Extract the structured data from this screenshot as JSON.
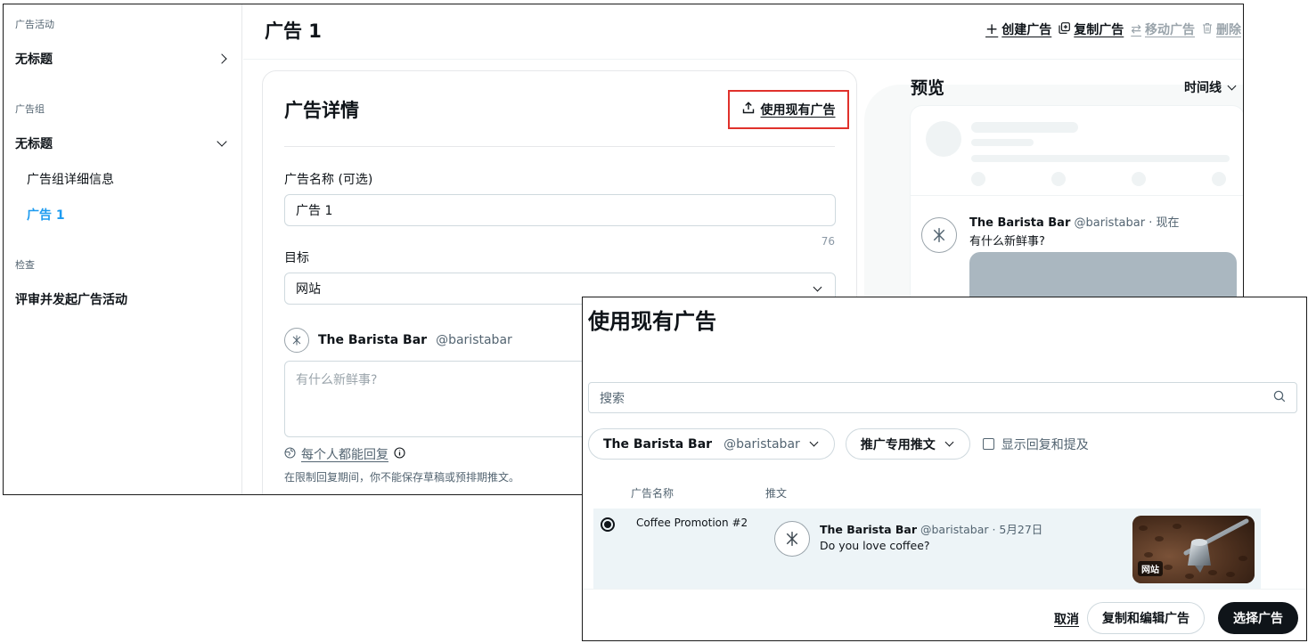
{
  "sidebar": {
    "campaign_section": "广告活动",
    "campaign_item": "无标题",
    "adgroup_section": "广告组",
    "adgroup_item": "无标题",
    "adgroup_details": "广告组详细信息",
    "ad_item": "广告 1",
    "review_section": "检查",
    "review_item": "评审并发起广告活动"
  },
  "header": {
    "title": "广告 1",
    "actions": {
      "create": "创建广告",
      "duplicate": "复制广告",
      "move": "移动广告",
      "delete": "删除"
    }
  },
  "ad_details": {
    "title": "广告详情",
    "use_existing": "使用现有广告",
    "name_label": "广告名称 (可选)",
    "name_value": "广告 1",
    "name_counter": "76",
    "objective_label": "目标",
    "objective_value": "网站",
    "account_name": "The Barista Bar",
    "account_handle": "@baristabar",
    "compose_placeholder": "有什么新鲜事?",
    "reply_setting": "每个人都能回复",
    "reply_note": "在限制回复期间，你不能保存草稿或预排期推文。"
  },
  "preview": {
    "title": "预览",
    "view": "时间线",
    "tweet_name": "The Barista Bar",
    "tweet_meta": "@baristabar · 现在",
    "tweet_text": "有什么新鲜事?"
  },
  "dialog": {
    "title": "使用现有广告",
    "search_placeholder": "搜索",
    "account_filter_name": "The Barista Bar",
    "account_filter_handle": "@baristabar",
    "type_filter": "推广专用推文",
    "show_replies": "显示回复和提及",
    "col_name": "广告名称",
    "col_tweet": "推文",
    "rows": [
      {
        "name": "Coffee Promotion #2",
        "account_name": "The Barista Bar",
        "meta": "@baristabar · 5月27日",
        "text": "Do you love coffee?",
        "badge": "网站"
      }
    ],
    "cancel": "取消",
    "duplicate_edit": "复制和编辑广告",
    "select": "选择广告"
  },
  "colors": {
    "accent": "#1d9bf0",
    "highlight_border": "#e0312b",
    "primary_button": "#0f1419",
    "row_selected": "#edf4f7"
  }
}
